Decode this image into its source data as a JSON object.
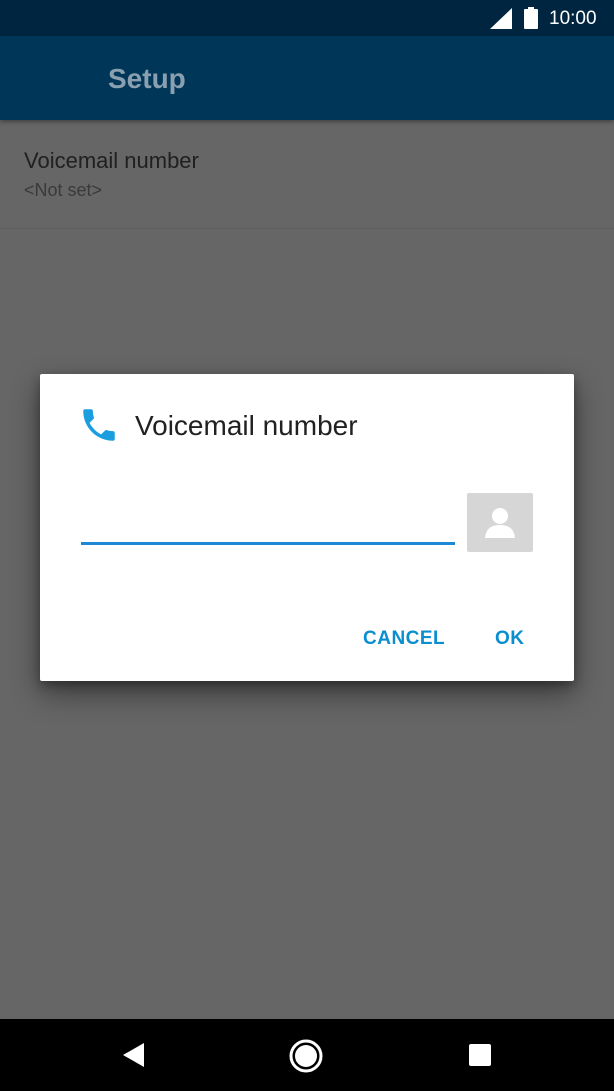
{
  "status_bar": {
    "time": "10:00",
    "icons": [
      "cell-signal-icon",
      "battery-icon"
    ]
  },
  "app_bar": {
    "title": "Setup"
  },
  "preference": {
    "title": "Voicemail number",
    "summary": "<Not set>"
  },
  "dialog": {
    "icon": "phone-icon",
    "title": "Voicemail number",
    "input_value": "",
    "input_placeholder": "",
    "contact_picker_icon": "contact-icon",
    "cancel_label": "CANCEL",
    "ok_label": "OK"
  },
  "nav_bar": {
    "icons": [
      "back-icon",
      "home-icon",
      "recents-icon"
    ]
  },
  "colors": {
    "status_bar": "#002540",
    "app_bar": "#003658",
    "scrim_background": "#666666",
    "accent": "#0a8ed0",
    "input_underline": "#1e88d6"
  }
}
